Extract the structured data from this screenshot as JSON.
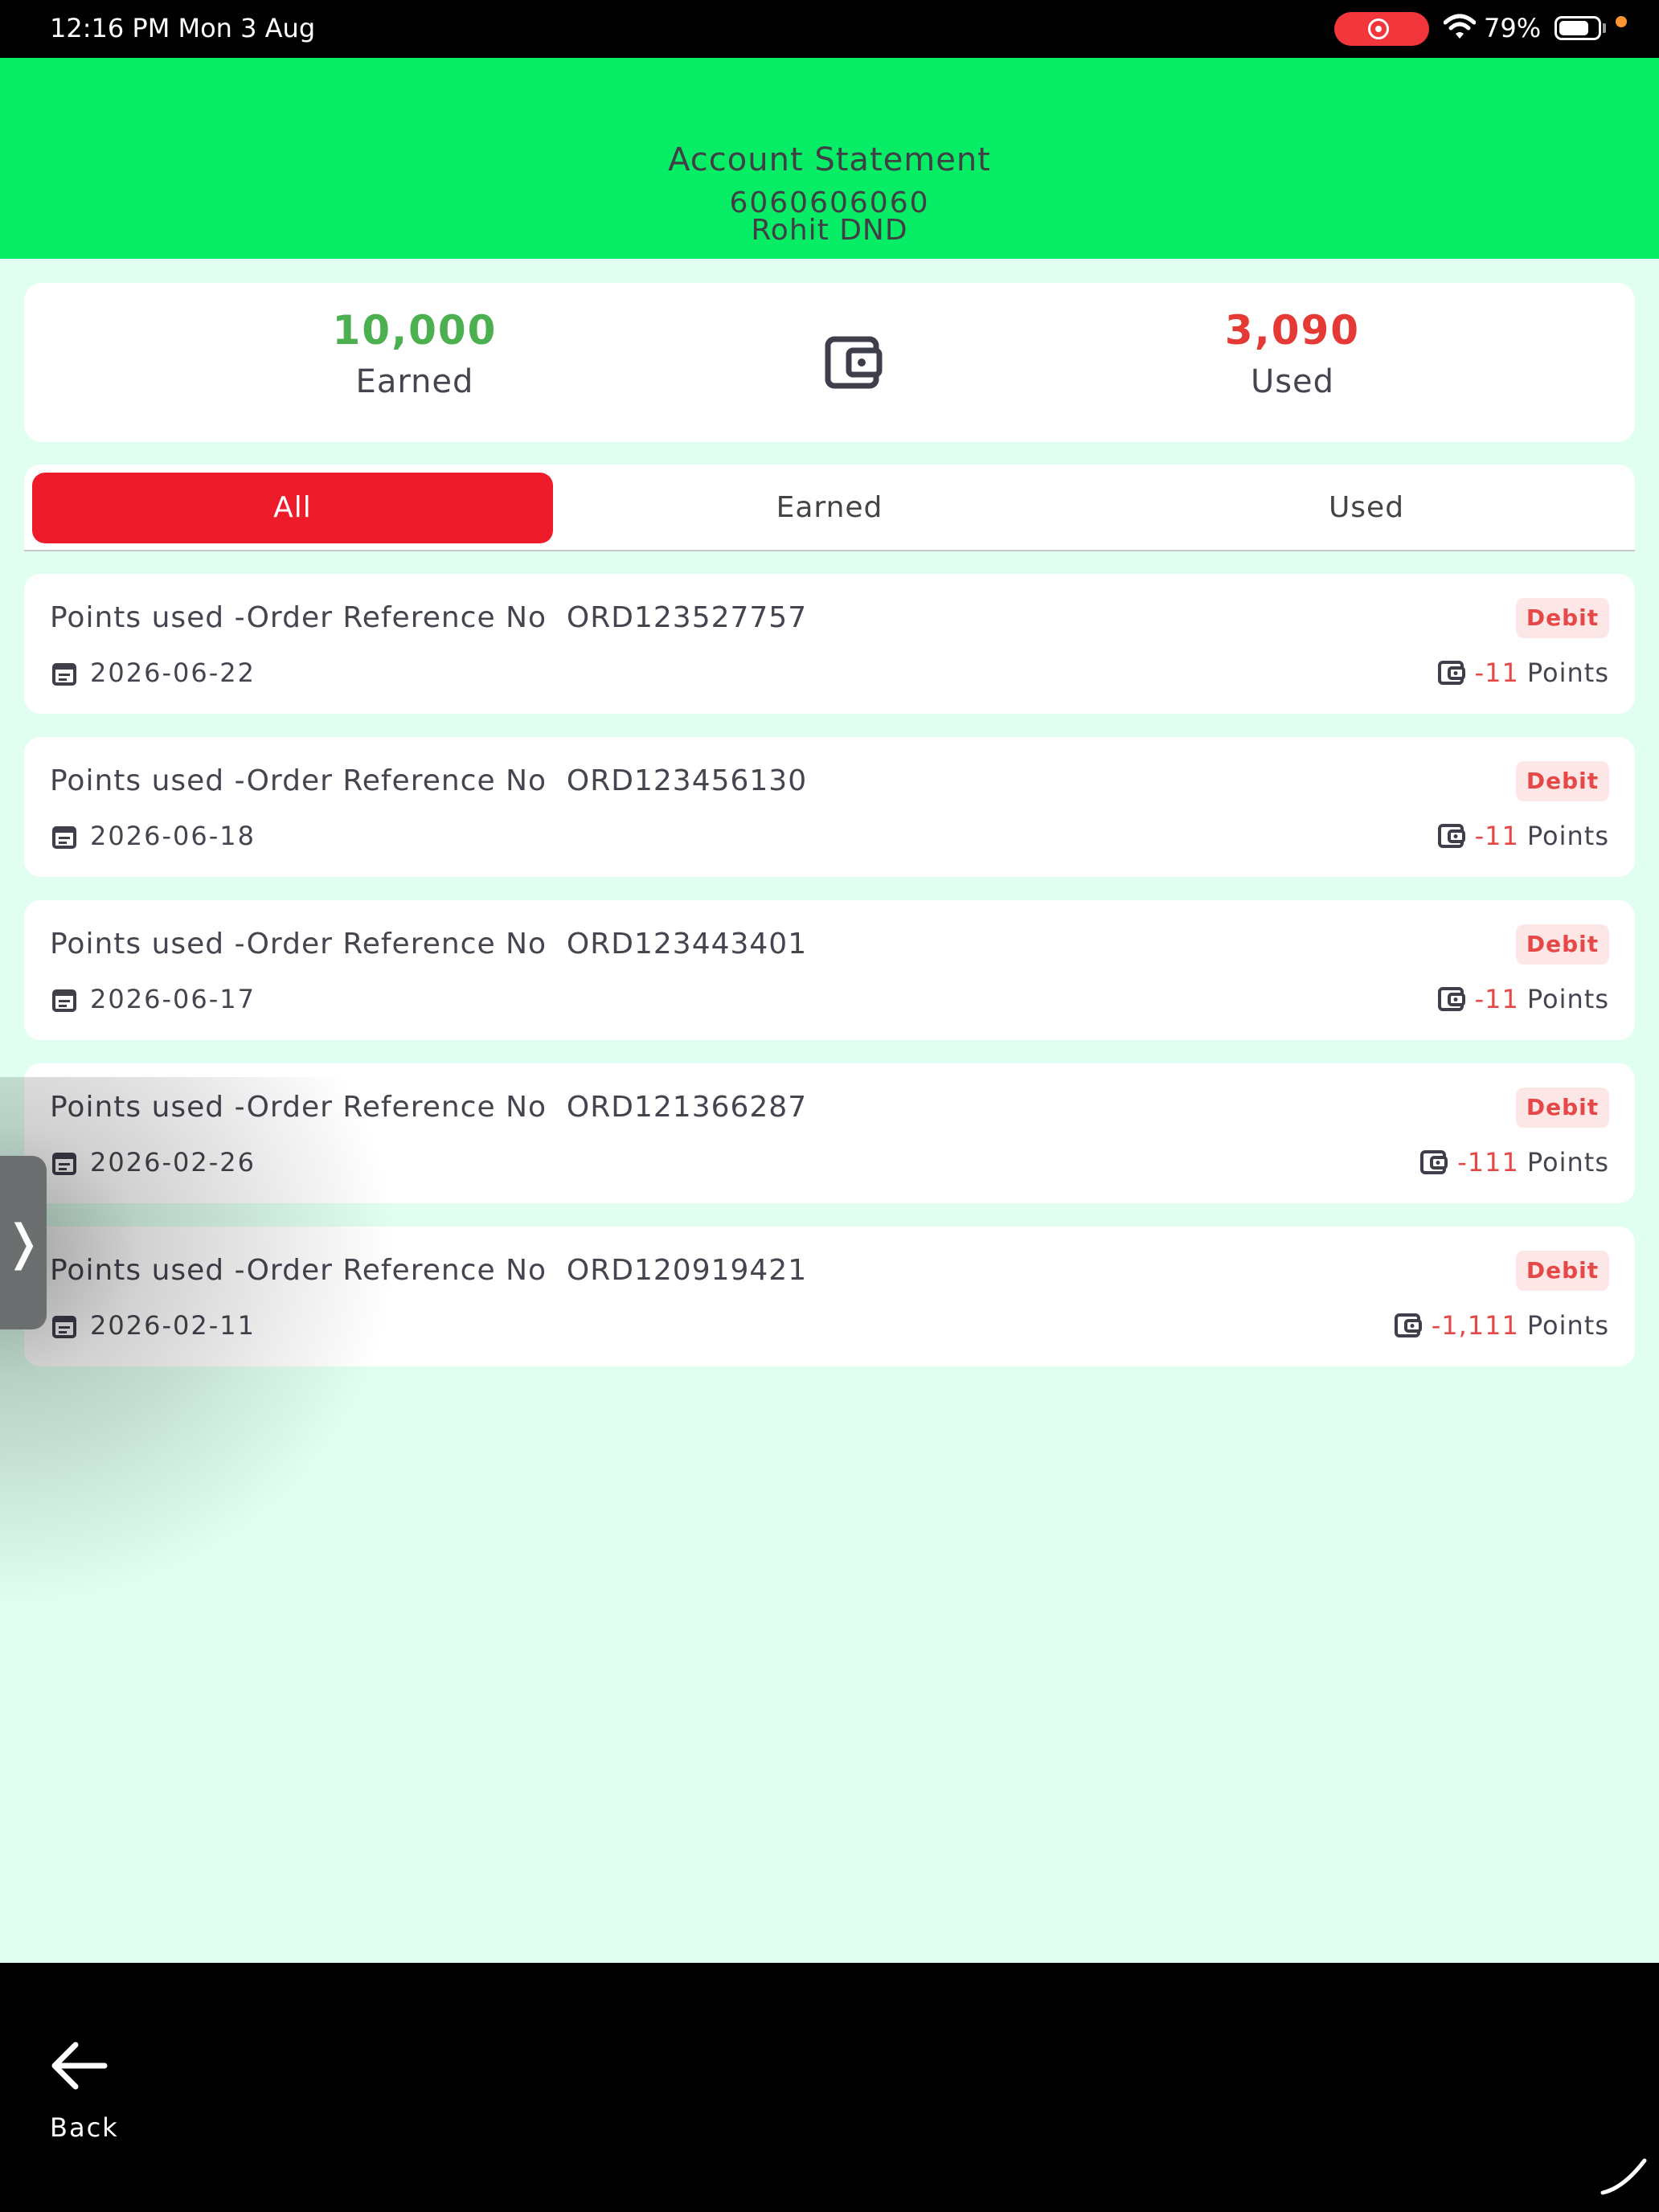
{
  "status_bar": {
    "time": "12:16 PM   Mon 3 Aug",
    "battery_pct": "79%",
    "battery_level": 0.79,
    "icons": [
      "screen-record-icon",
      "wifi-icon",
      "battery-icon",
      "orange-dot-indicator"
    ]
  },
  "header": {
    "title": "Account Statement",
    "phone": "6060606060",
    "name": "Rohit DND",
    "color": "#07ee66"
  },
  "summary": {
    "earned_value": "10,000",
    "earned_label": "Earned",
    "used_value": "3,090",
    "used_label": "Used",
    "earned_color": "#4caf50",
    "used_color": "#e53935",
    "center_icon": "wallet-icon"
  },
  "tabs": [
    {
      "label": "All",
      "active": true
    },
    {
      "label": "Earned",
      "active": false
    },
    {
      "label": "Used",
      "active": false
    }
  ],
  "transactions": [
    {
      "description": "Points used -Order Reference No  ORD123527757",
      "badge": "Debit",
      "date": "2026-06-22",
      "amount": "-11",
      "unit": "Points"
    },
    {
      "description": "Points used -Order Reference No  ORD123456130",
      "badge": "Debit",
      "date": "2026-06-18",
      "amount": "-11",
      "unit": "Points"
    },
    {
      "description": "Points used -Order Reference No  ORD123443401",
      "badge": "Debit",
      "date": "2026-06-17",
      "amount": "-11",
      "unit": "Points"
    },
    {
      "description": "Points used -Order Reference No  ORD121366287",
      "badge": "Debit",
      "date": "2026-02-26",
      "amount": "-111",
      "unit": "Points"
    },
    {
      "description": "Points used -Order Reference No  ORD120919421",
      "badge": "Debit",
      "date": "2026-02-11",
      "amount": "-1,111",
      "unit": "Points"
    }
  ],
  "side_handle": {
    "glyph": "❭"
  },
  "bottom": {
    "back_label": "Back"
  }
}
